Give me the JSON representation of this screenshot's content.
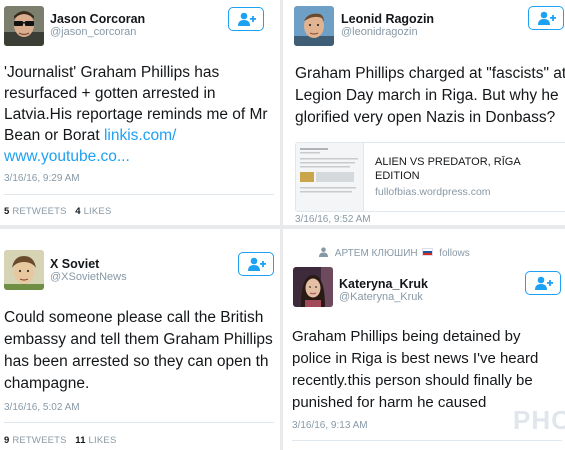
{
  "tweets": [
    {
      "name": "Jason Corcoran",
      "handle": "@jason_corcoran",
      "text_lines": [
        "'Journalist' Graham Phillips has",
        "resurfaced + gotten arrested in",
        "Latvia.His reportage reminds me of Mr",
        "Bean or Borat "
      ],
      "link1": "linkis.com/",
      "link2": "www.youtube.co...",
      "date": "3/16/16, 9:29 AM",
      "retweets": "5",
      "retweets_label": "RETWEETS",
      "likes": "4",
      "likes_label": "LIKES"
    },
    {
      "name": "Leonid Ragozin",
      "handle": "@leonidragozin",
      "text_lines": [
        "Graham Phillips charged at \"fascists\" at",
        "Legion Day march in Riga. But why he",
        "glorified very open Nazis in Donbass?"
      ],
      "card_title_1": "ALIEN VS PREDATOR, RĪGA",
      "card_title_2": "EDITION",
      "card_domain": "fullofbias.wordpress.com",
      "date": "3/16/16, 9:52 AM"
    },
    {
      "name": "X Soviet",
      "handle": "@XSovietNews",
      "text_lines": [
        "Could someone please call the British",
        "embassy and tell them Graham Phillips",
        "has been arrested so they can open th",
        "champagne."
      ],
      "date": "3/16/16, 5:02 AM",
      "retweets": "9",
      "retweets_label": "RETWEETS",
      "likes": "11",
      "likes_label": "LIKES"
    },
    {
      "context": "АРТЕМ КЛЮШИН",
      "context_suffix": "follows",
      "name": "Kateryna_Kruk",
      "handle": "@Kateryna_Kruk",
      "text_lines": [
        "Graham Phillips being detained by",
        "police in Riga is best news I've heard",
        "recently.this person should finally be",
        "punished for harm he caused"
      ],
      "date": "3/16/16, 9:13 AM"
    }
  ],
  "watermark": "PHOTO",
  "colors": {
    "accent": "#1da1f2",
    "text": "#14171a",
    "muted": "#8899a6",
    "divider": "#e1e8ed"
  }
}
